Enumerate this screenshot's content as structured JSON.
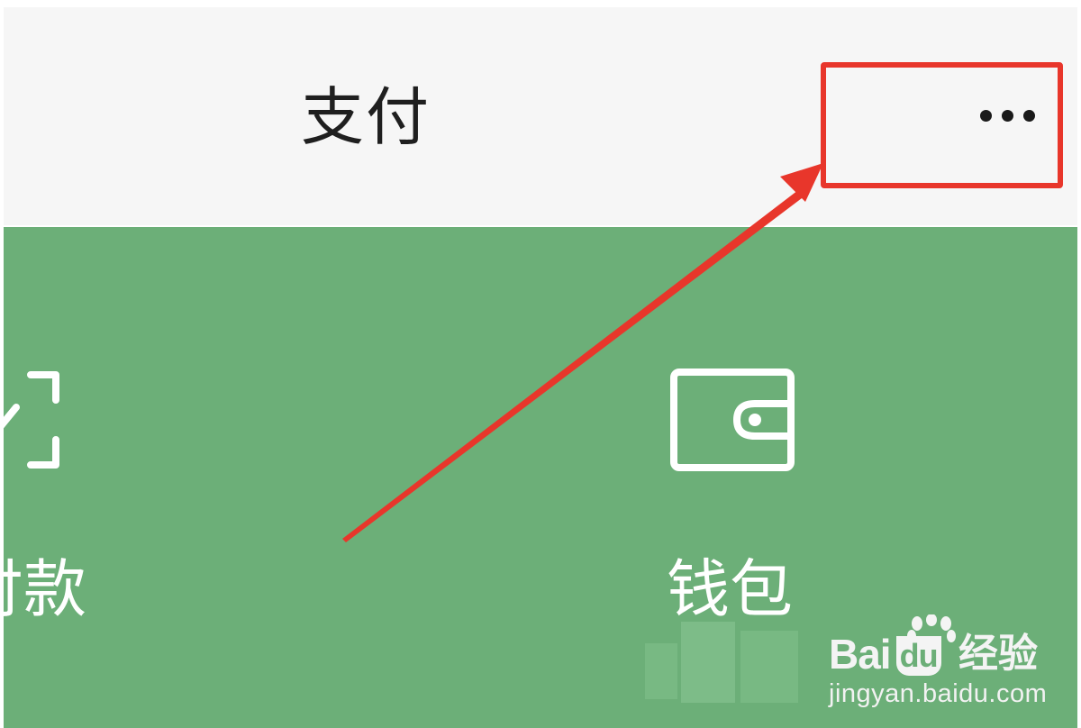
{
  "header": {
    "title": "支付",
    "more_icon": "more-dots-icon"
  },
  "features": [
    {
      "label": "付款",
      "icon": "scan-frame-icon"
    },
    {
      "label": "钱包",
      "icon": "wallet-icon"
    }
  ],
  "annotation": {
    "highlight_color": "#e8362b",
    "target": "more-button"
  },
  "watermark": {
    "brand": "Bai",
    "brand_suffix": "du",
    "product": "经验",
    "url": "jingyan.baidu.com"
  },
  "colors": {
    "header_bg": "#f6f6f6",
    "panel_green": "#6caf78",
    "annotation_red": "#e8362b"
  }
}
